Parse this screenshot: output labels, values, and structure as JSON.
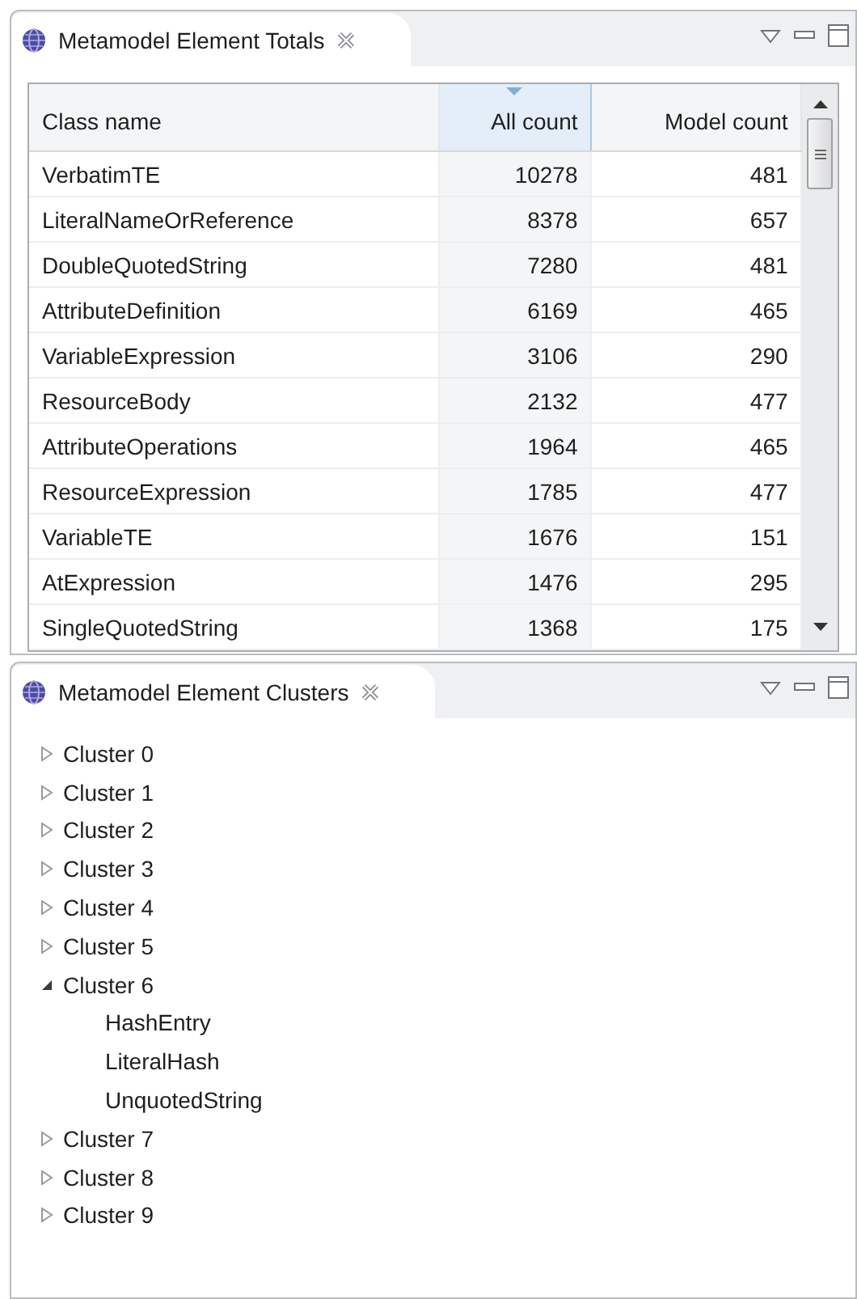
{
  "totals_view": {
    "title": "Metamodel Element Totals",
    "table": {
      "columns": [
        {
          "label": "Class name",
          "sorted": false
        },
        {
          "label": "All count",
          "sorted": true
        },
        {
          "label": "Model count",
          "sorted": false
        }
      ],
      "rows": [
        [
          "VerbatimTE",
          "10278",
          "481"
        ],
        [
          "LiteralNameOrReference",
          "8378",
          "657"
        ],
        [
          "DoubleQuotedString",
          "7280",
          "481"
        ],
        [
          "AttributeDefinition",
          "6169",
          "465"
        ],
        [
          "VariableExpression",
          "3106",
          "290"
        ],
        [
          "ResourceBody",
          "2132",
          "477"
        ],
        [
          "AttributeOperations",
          "1964",
          "465"
        ],
        [
          "ResourceExpression",
          "1785",
          "477"
        ],
        [
          "VariableTE",
          "1676",
          "151"
        ],
        [
          "AtExpression",
          "1476",
          "295"
        ],
        [
          "SingleQuotedString",
          "1368",
          "175"
        ]
      ]
    }
  },
  "clusters_view": {
    "title": "Metamodel Element Clusters",
    "tree": [
      {
        "label": "Cluster 0",
        "expanded": false
      },
      {
        "label": "Cluster 1",
        "expanded": false
      },
      {
        "label": "Cluster 2",
        "expanded": false
      },
      {
        "label": "Cluster 3",
        "expanded": false
      },
      {
        "label": "Cluster 4",
        "expanded": false
      },
      {
        "label": "Cluster 5",
        "expanded": false
      },
      {
        "label": "Cluster 6",
        "expanded": true,
        "children": [
          {
            "label": "HashEntry"
          },
          {
            "label": "LiteralHash"
          },
          {
            "label": "UnquotedString"
          }
        ]
      },
      {
        "label": "Cluster 7",
        "expanded": false
      },
      {
        "label": "Cluster 8",
        "expanded": false
      },
      {
        "label": "Cluster 9",
        "expanded": false
      }
    ]
  }
}
